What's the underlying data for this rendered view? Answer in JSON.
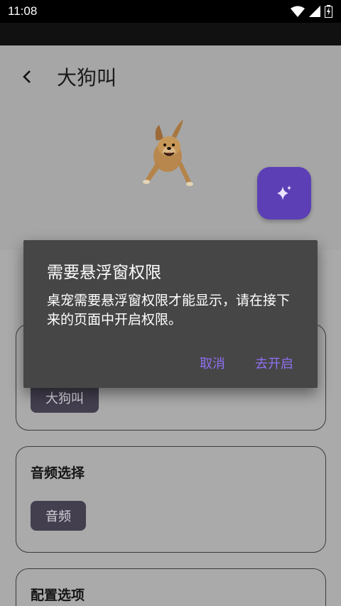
{
  "status": {
    "time": "11:08"
  },
  "header": {
    "title": "大狗叫"
  },
  "cards": [
    {
      "title": "",
      "chip": "大狗叫"
    },
    {
      "title": "音频选择",
      "chip": "音频"
    },
    {
      "title": "配置选项"
    }
  ],
  "dialog": {
    "title": "需要悬浮窗权限",
    "message": "桌宠需要悬浮窗权限才能显示，请在接下来的页面中开启权限。",
    "cancel_label": "取消",
    "confirm_label": "去开启"
  },
  "colors": {
    "accent": "#5c3fb5",
    "dialog_button": "#8f6ff0",
    "dialog_bg": "#464646"
  }
}
